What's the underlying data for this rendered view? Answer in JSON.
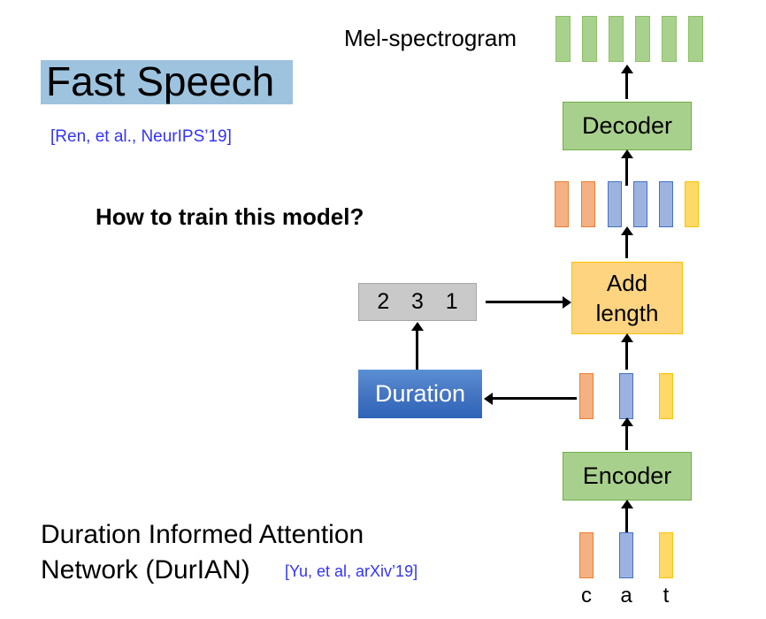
{
  "slide": {
    "title": "Fast Speech",
    "title_citation": "[Ren, et al., NeurIPS’19]",
    "question": "How to train this model?",
    "durian_line1": "Duration Informed Attention",
    "durian_line2": "Network (DurIAN)",
    "durian_citation": "[Yu, et al, arXiv’19]",
    "mel_label": "Mel-spectrogram",
    "highlight_color": "#9dc3de",
    "citation_color": "#3333ff"
  },
  "diagram": {
    "boxes": {
      "decoder": "Decoder",
      "encoder": "Encoder",
      "duration": "Duration",
      "add_length_line1": "Add",
      "add_length_line2": "length"
    },
    "durations": [
      "2",
      "3",
      "1"
    ],
    "phonemes": [
      "c",
      "a",
      "t"
    ],
    "colors": {
      "green_fill": "#a8d08d",
      "green_stroke": "#70ad47",
      "orange_fill": "#ffd480",
      "orange_stroke": "#ffc000",
      "blue_fill": "#4472c4",
      "gray_fill": "#c9c9c9",
      "bar_orange": "#f4b183",
      "bar_blue": "#9cb3e0",
      "bar_yellow": "#ffd966",
      "bar_green": "#a9d18e"
    },
    "sequences": {
      "mel_bars": [
        "green",
        "green",
        "green",
        "green",
        "green",
        "green"
      ],
      "expanded_bars": [
        "orange",
        "orange",
        "blue",
        "blue",
        "blue",
        "yellow"
      ],
      "encoder_output_bars": [
        "orange",
        "blue",
        "yellow"
      ],
      "input_bars": [
        "orange",
        "blue",
        "yellow"
      ]
    }
  }
}
